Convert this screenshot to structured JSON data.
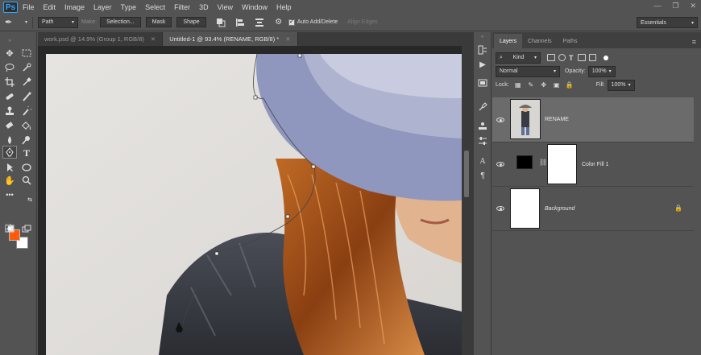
{
  "app": {
    "logo": "Ps",
    "menu": [
      "File",
      "Edit",
      "Image",
      "Layer",
      "Type",
      "Select",
      "Filter",
      "3D",
      "View",
      "Window",
      "Help"
    ]
  },
  "options": {
    "mode_select": "Path",
    "make_label": "Make:",
    "selection_button": "Selection...",
    "mask_button": "Mask",
    "shape_button": "Shape",
    "auto_add_delete_label": "Auto Add/Delete",
    "align_edges_label": "Align Edges",
    "workspace": "Essentials"
  },
  "documents": {
    "tabs": [
      {
        "label": "work.psd @ 14.9% (Group 1, RGB/8)",
        "active": false
      },
      {
        "label": "Untitled-1 @ 93.4% (RENAME, RGB/8) *",
        "active": true
      }
    ]
  },
  "colors": {
    "foreground": "#ff5a0a",
    "background": "#ffffff",
    "hat": "#8f97be",
    "hair": "#b25a1e",
    "jacket": "#3a3c44"
  },
  "layers_panel": {
    "tabs": [
      "Layers",
      "Channels",
      "Paths"
    ],
    "filter_label": "Kind",
    "blend_mode": "Normal",
    "opacity_label": "Opacity:",
    "opacity_value": "100%",
    "lock_label": "Lock:",
    "fill_label": "Fill:",
    "fill_value": "100%",
    "layers": [
      {
        "name": "RENAME",
        "selected": true
      },
      {
        "name": "Color Fill 1",
        "selected": false
      },
      {
        "name": "Background",
        "selected": false,
        "locked": true
      }
    ]
  }
}
